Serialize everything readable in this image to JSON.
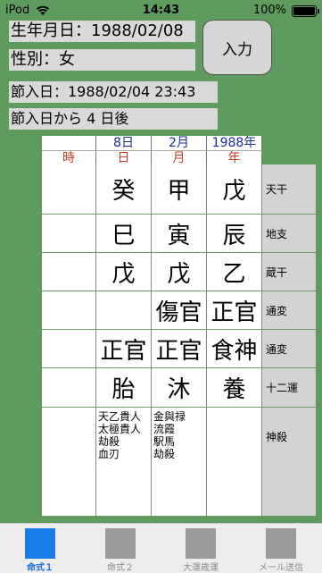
{
  "status_bar": {
    "device": "iPod",
    "time": "14:43",
    "battery": "100%"
  },
  "info": {
    "birthdate": "生年月日：1988/02/08",
    "gender": "性別：女",
    "setsuiri": "節入日：1988/02/04 23:43",
    "after": "節入日から 4 日後"
  },
  "input_button": "入力",
  "chart": {
    "header": [
      "8日",
      "2月",
      "1988年"
    ],
    "subheader": [
      "時",
      "日",
      "月",
      "年"
    ],
    "rows": [
      {
        "label": "天干",
        "cells": [
          "",
          "癸",
          "甲",
          "戊"
        ]
      },
      {
        "label": "地支",
        "cells": [
          "",
          "巳",
          "寅",
          "辰"
        ]
      },
      {
        "label": "蔵干",
        "cells": [
          "",
          "戊",
          "戊",
          "乙"
        ]
      },
      {
        "label": "通変",
        "cells": [
          "",
          "",
          "傷官",
          "正官"
        ]
      },
      {
        "label": "通変",
        "cells": [
          "",
          "正官",
          "正官",
          "食神"
        ]
      },
      {
        "label": "十二運",
        "cells": [
          "",
          "胎",
          "沐",
          "養"
        ]
      }
    ],
    "shinsatsu_label": "神殺",
    "shinsatsu": [
      [],
      [
        "天乙貴人",
        "太極貴人",
        "劫殺",
        "血刃"
      ],
      [
        "金與禄",
        "流霞",
        "駅馬",
        "劫殺"
      ],
      []
    ]
  },
  "tabs": [
    {
      "label": "命式１"
    },
    {
      "label": "命式２"
    },
    {
      "label": "大運歳運"
    },
    {
      "label": "メール送信"
    }
  ]
}
